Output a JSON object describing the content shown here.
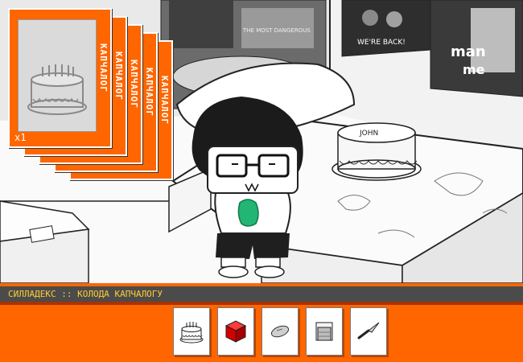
{
  "sylladex": {
    "modus_label": "КАПЧАЛОГ",
    "quantity": "x1",
    "card_count": 5
  },
  "captcha_bar": {
    "title": "СИЛЛАДЕКС :: КОЛОДА КАПЧАЛОГУ"
  },
  "inventory": [
    {
      "item": "cake",
      "icon": "cake-icon"
    },
    {
      "item": "red-box",
      "icon": "red-box-icon"
    },
    {
      "item": "pill",
      "icon": "pill-icon"
    },
    {
      "item": "paper-stack",
      "icon": "paper-stack-icon"
    },
    {
      "item": "knife",
      "icon": "knife-icon"
    }
  ],
  "colors": {
    "bar": "#ff6600",
    "title_bg": "#4b4b4b",
    "title_text": "#ffcc33",
    "accent_dark": "#a83300"
  }
}
